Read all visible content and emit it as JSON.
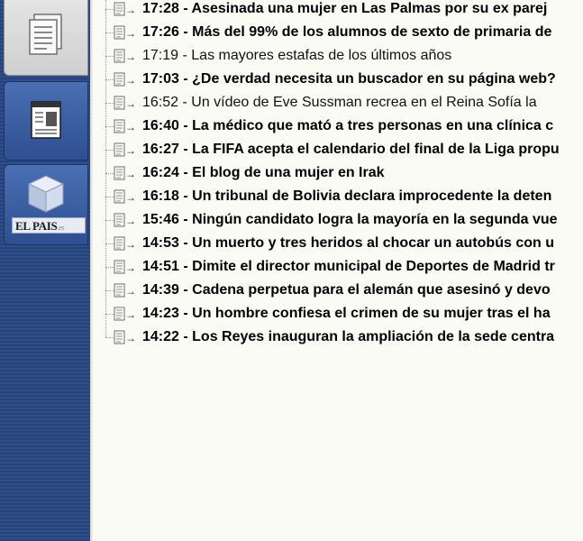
{
  "sidebar": {
    "brand": {
      "name": "EL PAIS",
      "tld": ".es"
    }
  },
  "news": [
    {
      "time": "17:28",
      "headline": "Asesinada una mujer en Las Palmas por su ex parej",
      "bold": true
    },
    {
      "time": "17:26",
      "headline": "Más del 99% de los alumnos de sexto de primaria de",
      "bold": true
    },
    {
      "time": "17:19",
      "headline": "Las mayores estafas de los últimos años",
      "bold": false
    },
    {
      "time": "17:03",
      "headline": "¿De verdad necesita un buscador en su página web?",
      "bold": true
    },
    {
      "time": "16:52",
      "headline": "Un vídeo de Eve Sussman recrea en el Reina Sofía la",
      "bold": false
    },
    {
      "time": "16:40",
      "headline": "La médico que mató a tres personas en una clínica c",
      "bold": true
    },
    {
      "time": "16:27",
      "headline": "La FIFA acepta el calendario del final de la Liga propu",
      "bold": true
    },
    {
      "time": "16:24",
      "headline": "El blog de una mujer en Irak",
      "bold": true
    },
    {
      "time": "16:18",
      "headline": "Un tribunal de Bolivia declara improcedente la deten",
      "bold": true
    },
    {
      "time": "15:46",
      "headline": "Ningún candidato logra la mayoría en la segunda vue",
      "bold": true
    },
    {
      "time": "14:53",
      "headline": "Un muerto y tres heridos al chocar un autobús con u",
      "bold": true
    },
    {
      "time": "14:51",
      "headline": "Dimite el director municipal de Deportes de Madrid tr",
      "bold": true
    },
    {
      "time": "14:39",
      "headline": "Cadena perpetua para el alemán que asesinó y devo",
      "bold": true
    },
    {
      "time": "14:23",
      "headline": "Un hombre confiesa el crimen de su mujer tras el ha",
      "bold": true
    },
    {
      "time": "14:22",
      "headline": "Los Reyes inauguran la ampliación de la sede centra",
      "bold": true
    }
  ],
  "colors": {
    "sidebar": "#2c4a86",
    "panel": "#fbfbf6",
    "button_active": "#d8d8d8",
    "button": "#3d5fa3"
  }
}
